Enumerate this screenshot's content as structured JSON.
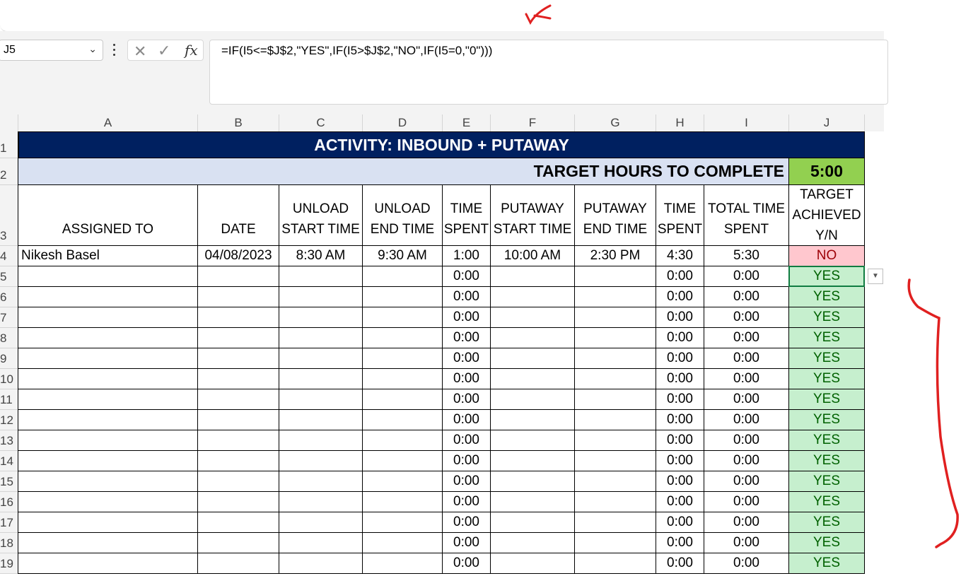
{
  "name_box": {
    "value": "J5"
  },
  "formula_bar": {
    "cancel_symbol": "✕",
    "enter_symbol": "✓",
    "fx_label": "fx",
    "formula": "=IF(I5<=$J$2,\"YES\",IF(I5>$J$2,\"NO\",IF(I5=0,\"0\")))"
  },
  "columns": [
    "A",
    "B",
    "C",
    "D",
    "E",
    "F",
    "G",
    "H",
    "I",
    "J"
  ],
  "rows": [
    "1",
    "2",
    "3",
    "4",
    "5",
    "6",
    "7",
    "8",
    "9",
    "10",
    "11",
    "12",
    "13",
    "14",
    "15",
    "16",
    "17",
    "18",
    "19"
  ],
  "sheet": {
    "title": "ACTIVITY: INBOUND + PUTAWAY",
    "target_label": "TARGET HOURS TO COMPLETE",
    "target_value": "5:00",
    "headers": {
      "assigned_to": "ASSIGNED TO",
      "date": "DATE",
      "unload_start": "UNLOAD START TIME",
      "unload_end": "UNLOAD END TIME",
      "time_spent_1": "TIME SPENT",
      "putaway_start": "PUTAWAY START TIME",
      "putaway_end": "PUTAWAY END TIME",
      "time_spent_2": "TIME SPENT",
      "total_time": "TOTAL TIME SPENT",
      "target_achieved": "TARGET ACHIEVED Y/N"
    },
    "data_rows": [
      [
        "Nikesh Basel",
        "04/08/2023",
        "8:30 AM",
        "9:30 AM",
        "1:00",
        "10:00 AM",
        "2:30 PM",
        "4:30",
        "5:30",
        "NO"
      ],
      [
        "",
        "",
        "",
        "",
        "0:00",
        "",
        "",
        "0:00",
        "0:00",
        "YES"
      ],
      [
        "",
        "",
        "",
        "",
        "0:00",
        "",
        "",
        "0:00",
        "0:00",
        "YES"
      ],
      [
        "",
        "",
        "",
        "",
        "0:00",
        "",
        "",
        "0:00",
        "0:00",
        "YES"
      ],
      [
        "",
        "",
        "",
        "",
        "0:00",
        "",
        "",
        "0:00",
        "0:00",
        "YES"
      ],
      [
        "",
        "",
        "",
        "",
        "0:00",
        "",
        "",
        "0:00",
        "0:00",
        "YES"
      ],
      [
        "",
        "",
        "",
        "",
        "0:00",
        "",
        "",
        "0:00",
        "0:00",
        "YES"
      ],
      [
        "",
        "",
        "",
        "",
        "0:00",
        "",
        "",
        "0:00",
        "0:00",
        "YES"
      ],
      [
        "",
        "",
        "",
        "",
        "0:00",
        "",
        "",
        "0:00",
        "0:00",
        "YES"
      ],
      [
        "",
        "",
        "",
        "",
        "0:00",
        "",
        "",
        "0:00",
        "0:00",
        "YES"
      ],
      [
        "",
        "",
        "",
        "",
        "0:00",
        "",
        "",
        "0:00",
        "0:00",
        "YES"
      ],
      [
        "",
        "",
        "",
        "",
        "0:00",
        "",
        "",
        "0:00",
        "0:00",
        "YES"
      ],
      [
        "",
        "",
        "",
        "",
        "0:00",
        "",
        "",
        "0:00",
        "0:00",
        "YES"
      ],
      [
        "",
        "",
        "",
        "",
        "0:00",
        "",
        "",
        "0:00",
        "0:00",
        "YES"
      ],
      [
        "",
        "",
        "",
        "",
        "0:00",
        "",
        "",
        "0:00",
        "0:00",
        "YES"
      ],
      [
        "",
        "",
        "",
        "",
        "0:00",
        "",
        "",
        "0:00",
        "0:00",
        "YES"
      ]
    ]
  },
  "colors": {
    "title_bg": "#002060",
    "target_label_bg": "#d9e1f2",
    "target_value_bg": "#92d050",
    "yes_bg": "#c6efce",
    "yes_text": "#006100",
    "no_bg": "#ffc7ce",
    "no_text": "#9c0006",
    "annotation": "#e02020"
  }
}
